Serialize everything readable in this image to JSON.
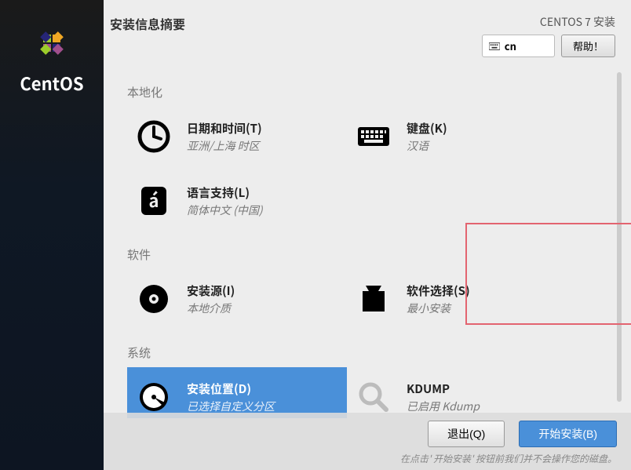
{
  "brand": "CentOS",
  "topbar": {
    "title": "安装信息摘要",
    "install_label": "CENTOS 7 安装",
    "keyboard_layout": "cn",
    "help_label": "帮助！"
  },
  "sections": {
    "localization": {
      "title": "本地化",
      "datetime": {
        "title": "日期和时间(T)",
        "status": "亚洲/上海 时区"
      },
      "keyboard": {
        "title": "键盘(K)",
        "status": "汉语"
      },
      "language": {
        "title": "语言支持(L)",
        "status": "简体中文 (中国)"
      }
    },
    "software": {
      "title": "软件",
      "source": {
        "title": "安装源(I)",
        "status": "本地介质"
      },
      "selection": {
        "title": "软件选择(S)",
        "status": "最小安装"
      }
    },
    "system": {
      "title": "系统",
      "destination": {
        "title": "安装位置(D)",
        "status": "已选择自定义分区"
      },
      "kdump": {
        "title": "KDUMP",
        "status": "已启用 Kdump"
      }
    }
  },
  "bottom": {
    "quit": "退出(Q)",
    "begin": "开始安装(B)",
    "hint": "在点击' 开始安装' 按钮前我们并不会操作您的磁盘。"
  }
}
